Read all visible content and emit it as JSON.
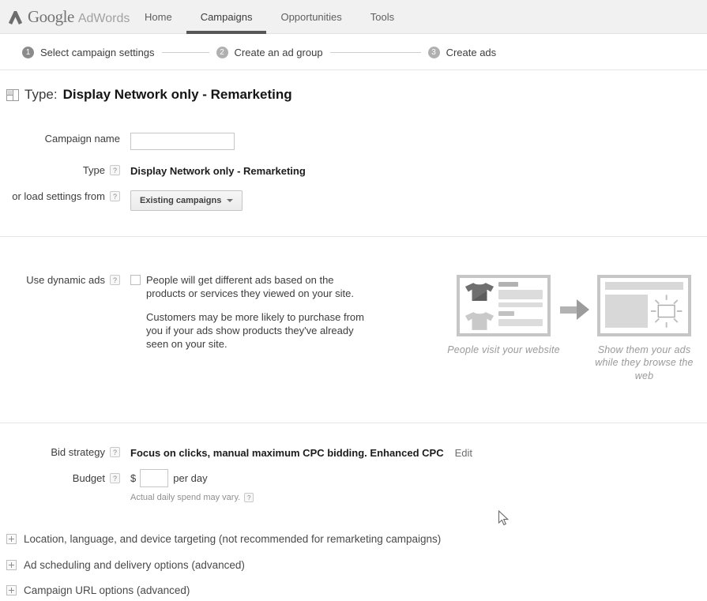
{
  "header": {
    "logo": {
      "google": "Google",
      "product": "AdWords"
    },
    "nav": [
      {
        "label": "Home",
        "active": false
      },
      {
        "label": "Campaigns",
        "active": true
      },
      {
        "label": "Opportunities",
        "active": false
      },
      {
        "label": "Tools",
        "active": false
      }
    ]
  },
  "steps": [
    {
      "number": "1",
      "label": "Select campaign settings"
    },
    {
      "number": "2",
      "label": "Create an ad group"
    },
    {
      "number": "3",
      "label": "Create ads"
    }
  ],
  "page_title": {
    "prefix": "Type:",
    "value": "Display Network only - Remarketing"
  },
  "form": {
    "campaign_name": {
      "label": "Campaign name",
      "value": ""
    },
    "type": {
      "label": "Type",
      "value": "Display Network only - Remarketing"
    },
    "load_settings": {
      "label": "or load settings from",
      "button_label": "Existing campaigns"
    },
    "dynamic_ads": {
      "label": "Use dynamic ads",
      "checkbox_text": "People will get different ads based on the products or services they viewed on your site.",
      "description": "Customers may be more likely to purchase from you if your ads show products they've already seen on your site."
    },
    "bid_strategy": {
      "label": "Bid strategy",
      "value": "Focus on clicks, manual maximum CPC bidding. Enhanced CPC",
      "edit_label": "Edit"
    },
    "budget": {
      "label": "Budget",
      "currency": "$",
      "value": "",
      "unit": "per day",
      "note": "Actual daily spend may vary."
    }
  },
  "illustration": {
    "left_caption": "People visit your website",
    "right_caption": "Show them your ads while they browse the web"
  },
  "advanced_sections": [
    {
      "label": "Location, language, and device targeting (not recommended for remarketing campaigns)"
    },
    {
      "label": "Ad scheduling and delivery options (advanced)"
    },
    {
      "label": "Campaign URL options (advanced)"
    }
  ],
  "colors": {
    "header_bg": "#f1f1f1",
    "active_tab_underline": "#575757",
    "step_current": "#8b8b8b",
    "step_upcoming": "#b0b0b0",
    "divider": "#e6e6e6"
  }
}
